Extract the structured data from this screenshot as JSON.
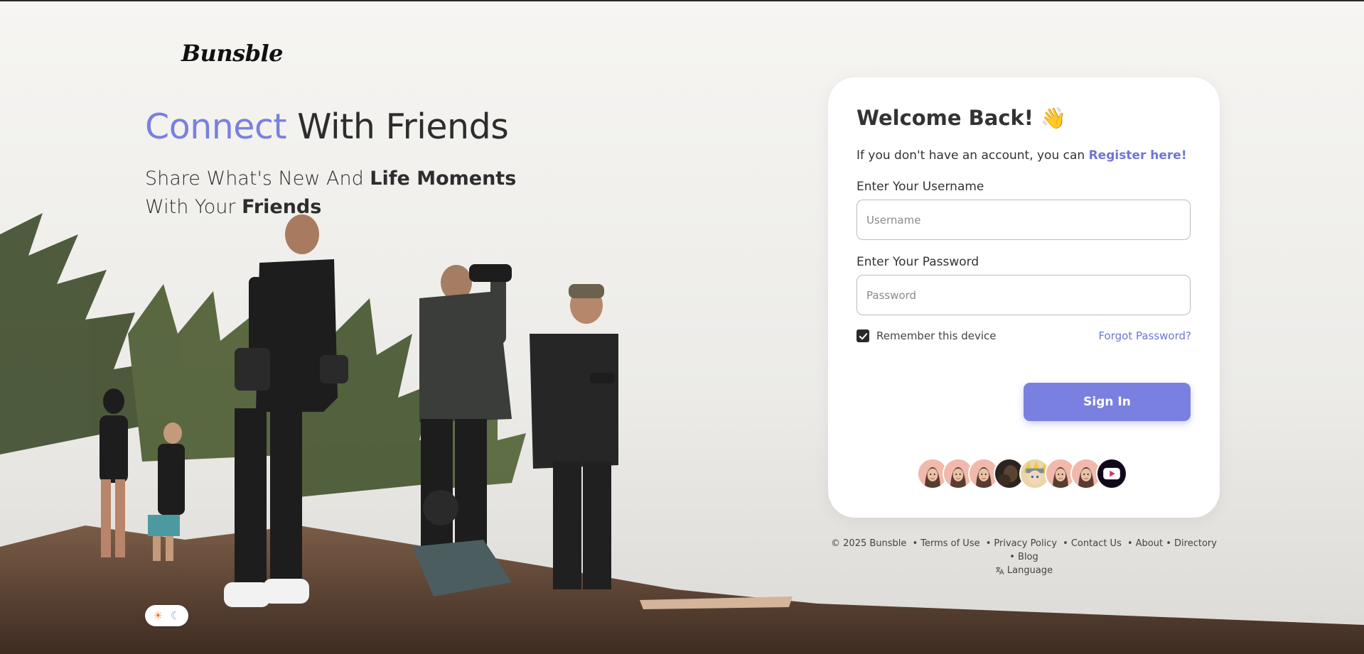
{
  "brand": {
    "logo": "Bunsble"
  },
  "hero": {
    "title_accent": "Connect",
    "title_rest": " With Friends",
    "sub_1": "Share What's New And ",
    "sub_bold_1": "Life Moments",
    "sub_2": " With Your ",
    "sub_bold_2": "Friends"
  },
  "theme": {
    "sun_icon": "☀",
    "moon_icon": "☾"
  },
  "login": {
    "heading": "Welcome Back!",
    "wave_icon": "👋",
    "register_prompt": "If you don't have an account, you can ",
    "register_link": "Register here!",
    "username_label": "Enter Your Username",
    "username_placeholder": "Username",
    "username_value": "",
    "password_label": "Enter Your Password",
    "password_placeholder": "Password",
    "password_value": "",
    "remember_label": "Remember this device",
    "remember_checked": true,
    "forgot_link": "Forgot Password?",
    "signin_button": "Sign In"
  },
  "avatars": [
    {
      "name": "avatar-1",
      "type": "memoji"
    },
    {
      "name": "avatar-2",
      "type": "memoji"
    },
    {
      "name": "avatar-3",
      "type": "memoji"
    },
    {
      "name": "avatar-4",
      "type": "photo-dark"
    },
    {
      "name": "avatar-5",
      "type": "anime"
    },
    {
      "name": "avatar-6",
      "type": "memoji"
    },
    {
      "name": "avatar-7",
      "type": "memoji"
    },
    {
      "name": "avatar-8",
      "type": "video-logo"
    }
  ],
  "footer": {
    "copyright": "© 2025 Bunsble",
    "links": [
      "Terms of Use",
      "Privacy Policy",
      "Contact Us",
      "About",
      "Directory",
      "Blog"
    ],
    "language": "Language"
  },
  "colors": {
    "accent": "#7a80df",
    "link": "#6f76d6",
    "text": "#2d2d2d"
  }
}
